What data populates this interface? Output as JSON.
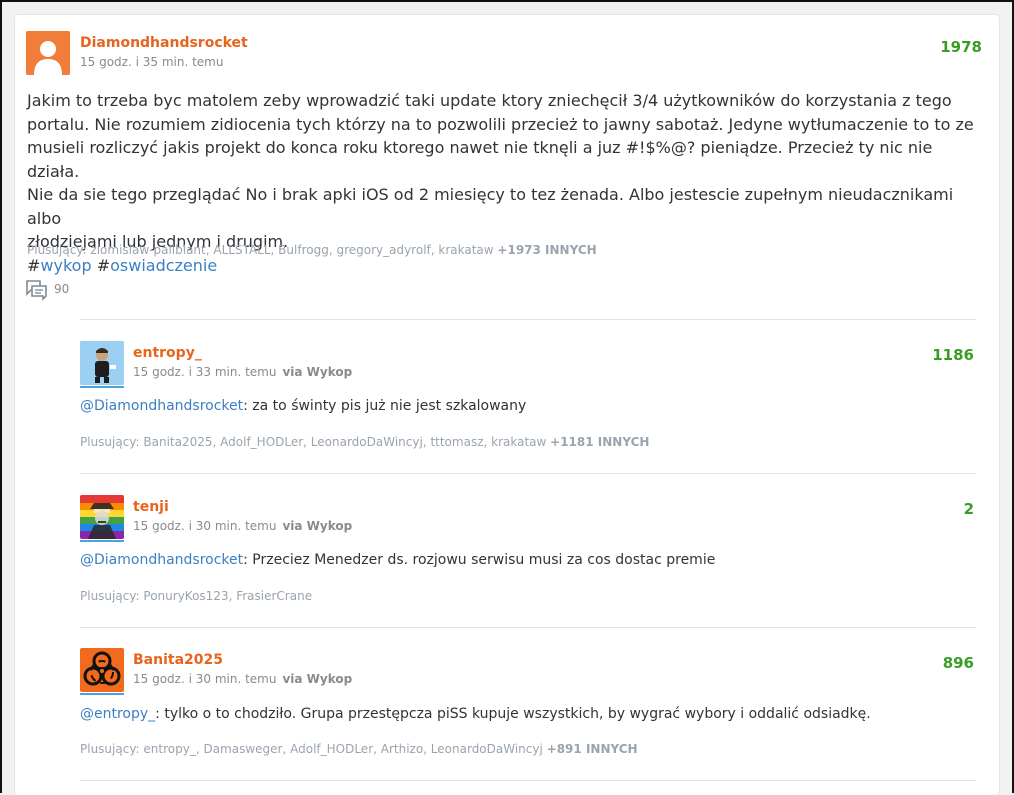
{
  "post": {
    "author": "Diamondhandsrocket",
    "time": "15 godz. i 35 min. temu",
    "score": "1978",
    "body_lines": [
      "Jakim to trzeba byc matolem zeby wprowadzić taki update ktory zniechęcił 3/4 użytkowników do korzystania z tego",
      "portalu. Nie rozumiem zidiocenia tych którzy na to pozwolili przecież to jawny sabotaż. Jedyne wytłumaczenie to to ze",
      "musieli rozliczyć jakis projekt do konca roku ktorego nawet nie tknęli a juz #!$%@? pieniądze. Przecież ty nic nie działa.",
      "Nie da sie tego przeglądać No i brak apki iOS od 2 miesięcy to tez żenada. Albo jestescie zupełnym nieudacznikami albo",
      "złodziejami lub jednym i drugim."
    ],
    "tags": [
      "wykop",
      "oswiadczenie"
    ],
    "hash": "#",
    "plusers_prefix": "Plusujący: ",
    "plusers": "ziomislaw-paliblant, ALLSTALL, Bulfrogg, gregory_adyrolf, krakataw",
    "plusers_more": "+1973 INNYCH",
    "comments_count": "90"
  },
  "comments": [
    {
      "author": "entropy_",
      "time": "15 godz. i 33 min. temu",
      "via": "via Wykop",
      "score": "1186",
      "mention": "@Diamondhandsrocket",
      "text": ": za to świnty pis już nie jest szkalowany",
      "plusers_prefix": "Plusujący: ",
      "plusers": "Banita2025, Adolf_HODLer, LeonardoDaWincyj, tttomasz, krakataw",
      "plusers_more": "+1181 INNYCH"
    },
    {
      "author": "tenji",
      "time": "15 godz. i 30 min. temu",
      "via": "via Wykop",
      "score": "2",
      "mention": "@Diamondhandsrocket",
      "text": ": Przeciez Menedzer ds. rozjowu serwisu musi za cos dostac premie",
      "plusers_prefix": "Plusujący: ",
      "plusers": "PonuryKos123, FrasierCrane",
      "plusers_more": ""
    },
    {
      "author": "Banita2025",
      "time": "15 godz. i 30 min. temu",
      "via": "via Wykop",
      "score": "896",
      "mention": "@entropy_",
      "text": ": tylko o to chodziło. Grupa przestępcza piSS kupuje wszystkich, by wygrać wybory i oddalić odsiadkę.",
      "plusers_prefix": "Plusujący: ",
      "plusers": "entropy_, Damasweger, Adolf_HODLer, Arthizo, LeonardoDaWincyj",
      "plusers_more": "+891 INNYCH"
    }
  ],
  "colors": {
    "author": "#e8641d",
    "score": "#3a9d23",
    "link": "#3b7fc4",
    "muted": "#8a8a8a"
  },
  "icons": {
    "default_avatar": "user-silhouette-icon",
    "comments": "comments-bubble-icon",
    "biohazard": "biohazard-icon"
  }
}
